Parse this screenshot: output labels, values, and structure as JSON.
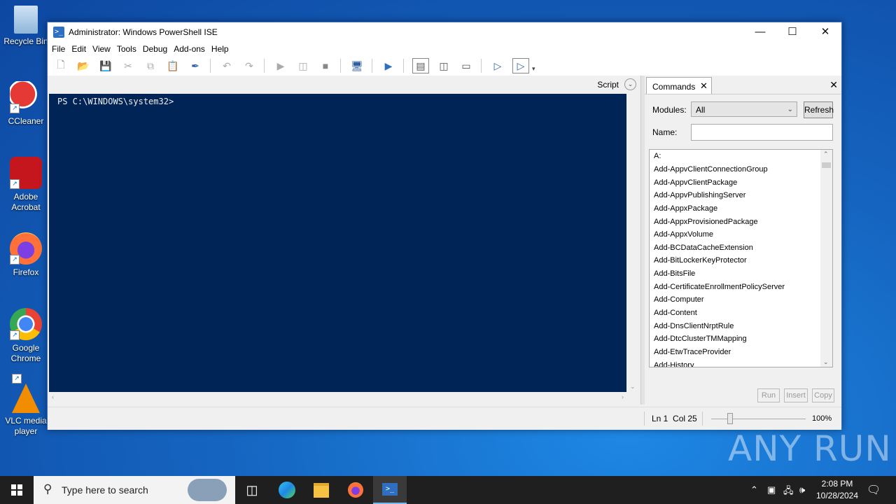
{
  "desktop": {
    "icons": [
      {
        "label": "Recycle Bin"
      },
      {
        "label": "CCleaner"
      },
      {
        "label": "Adobe Acrobat"
      },
      {
        "label": "Firefox"
      },
      {
        "label": "Google Chrome"
      },
      {
        "label": "VLC media player"
      }
    ]
  },
  "window": {
    "title": "Administrator: Windows PowerShell ISE",
    "menu": [
      "File",
      "Edit",
      "View",
      "Tools",
      "Debug",
      "Add-ons",
      "Help"
    ],
    "toolbar_icons": [
      "new-icon",
      "open-icon",
      "save-icon",
      "cut-icon",
      "copy-icon",
      "paste-icon",
      "clear-icon",
      "undo-icon",
      "redo-icon",
      "run-icon",
      "run-selection-icon",
      "stop-icon",
      "remote-icon",
      "powershell-icon",
      "layout-top-icon",
      "layout-right-icon",
      "layout-max-icon",
      "show-script-icon",
      "show-commands-icon"
    ],
    "editor": {
      "script_label": "Script",
      "console_prompt": "PS C:\\WINDOWS\\system32>"
    },
    "commands": {
      "tab_label": "Commands",
      "modules_label": "Modules:",
      "modules_value": "All",
      "refresh_label": "Refresh",
      "name_label": "Name:",
      "name_value": "",
      "items": [
        "A:",
        "Add-AppvClientConnectionGroup",
        "Add-AppvClientPackage",
        "Add-AppvPublishingServer",
        "Add-AppxPackage",
        "Add-AppxProvisionedPackage",
        "Add-AppxVolume",
        "Add-BCDataCacheExtension",
        "Add-BitLockerKeyProtector",
        "Add-BitsFile",
        "Add-CertificateEnrollmentPolicyServer",
        "Add-Computer",
        "Add-Content",
        "Add-DnsClientNrptRule",
        "Add-DtcClusterTMMapping",
        "Add-EtwTraceProvider",
        "Add-History"
      ],
      "run_label": "Run",
      "insert_label": "Insert",
      "copy_label": "Copy"
    },
    "status": {
      "position": "Ln 1  Col 25",
      "zoom": "100%",
      "zoom_level": 100
    }
  },
  "watermark": "ANY RUN",
  "taskbar": {
    "search_placeholder": "Type here to search",
    "time": "2:08 PM",
    "date": "10/28/2024"
  }
}
